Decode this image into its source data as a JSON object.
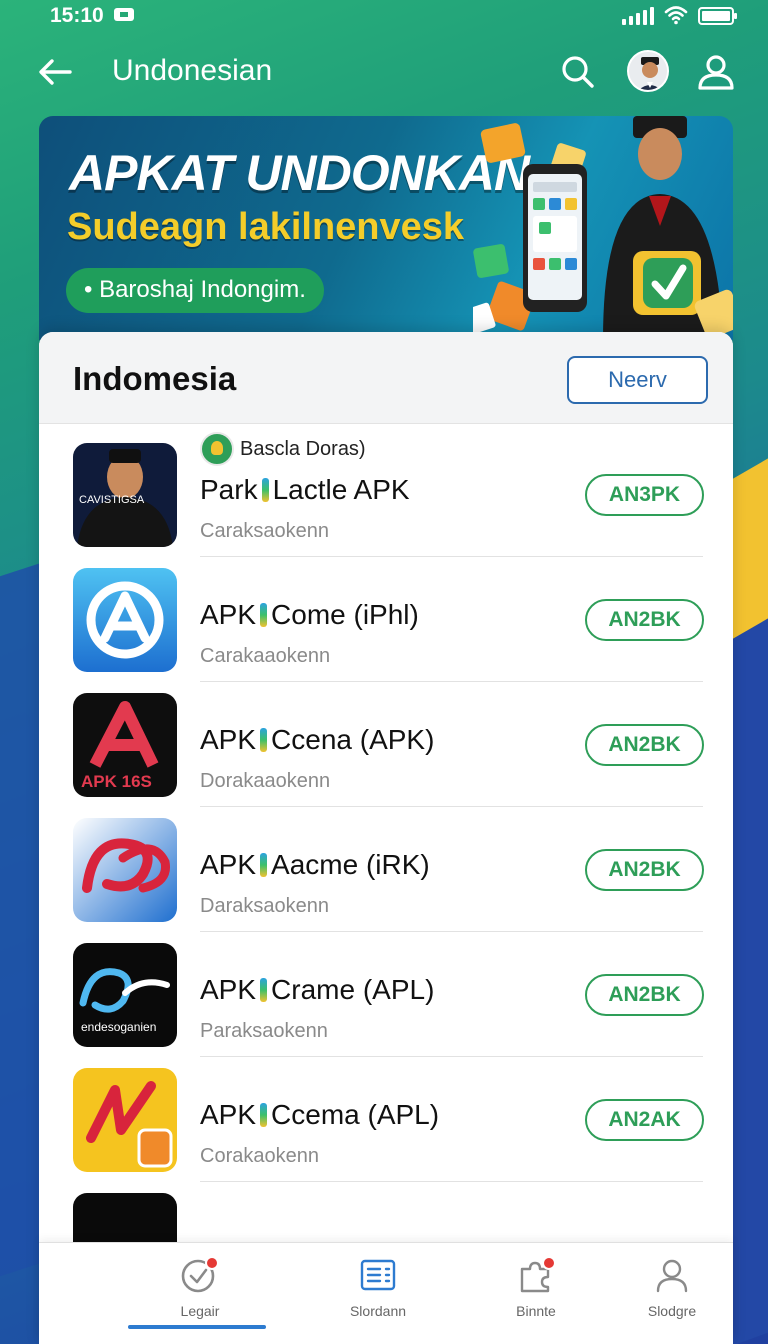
{
  "status_bar": {
    "time": "15:10"
  },
  "app_bar": {
    "title": "Undonesian"
  },
  "banner": {
    "title": "APKAT UNDONKAN",
    "subtitle": "Sudeagn lakilnenvesk",
    "pill": "• Baroshaj Indongim."
  },
  "section": {
    "title": "Indomesia",
    "new_button": "Neerv"
  },
  "apps": [
    {
      "source": "Bascla Doras)",
      "name_prefix": "Park",
      "name_suffix": "Lactle APK",
      "subtitle": "Caraksaokenn",
      "action": "AN3PK",
      "icon_text": "CAVISTIGSA"
    },
    {
      "name_prefix": "APK",
      "name_suffix": "Come (iPhl)",
      "subtitle": "Carakaaokenn",
      "action": "AN2BK",
      "icon_text": ""
    },
    {
      "name_prefix": "APK",
      "name_suffix": "Ccena (APK)",
      "subtitle": "Dorakaaokenn",
      "action": "AN2BK",
      "icon_text": "APK 16S"
    },
    {
      "name_prefix": "APK",
      "name_suffix": "Aacme (iRK)",
      "subtitle": "Daraksaokenn",
      "action": "AN2BK",
      "icon_text": ""
    },
    {
      "name_prefix": "APK",
      "name_suffix": "Crame (APL)",
      "subtitle": "Paraksaokenn",
      "action": "AN2BK",
      "icon_text": "endesoganien"
    },
    {
      "name_prefix": "APK",
      "name_suffix": "Ccema (APL)",
      "subtitle": "Corakaokenn",
      "action": "AN2AK",
      "icon_text": ""
    }
  ],
  "bottom_nav": [
    {
      "label": "Legair",
      "icon": "clock-icon",
      "active": true
    },
    {
      "label": "Slordann",
      "icon": "list-icon"
    },
    {
      "label": "Binnte",
      "icon": "puzzle-icon"
    },
    {
      "label": "Slodgre",
      "icon": "user-icon"
    }
  ],
  "colors": {
    "accent_green": "#2e9e58",
    "accent_blue": "#2c6aae",
    "banner_yellow": "#f4cd2a"
  }
}
